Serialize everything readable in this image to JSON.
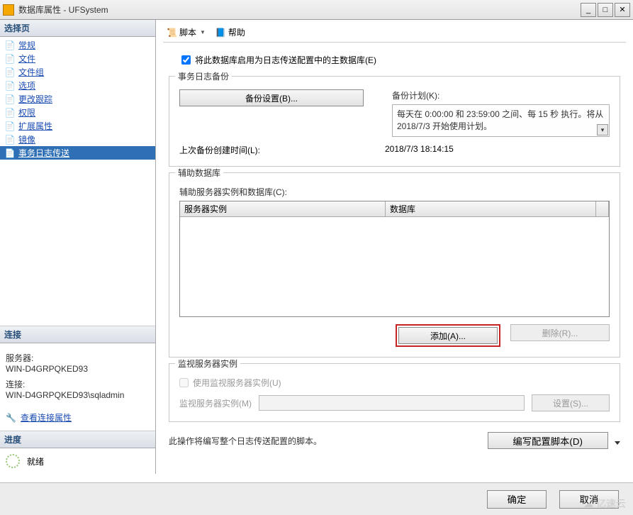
{
  "window": {
    "title": "数据库属性 - UFSystem"
  },
  "toolbar": {
    "script": "脚本",
    "help": "帮助"
  },
  "sidebar": {
    "select_page": "选择页",
    "items": [
      {
        "label": "常规"
      },
      {
        "label": "文件"
      },
      {
        "label": "文件组"
      },
      {
        "label": "选项"
      },
      {
        "label": "更改跟踪"
      },
      {
        "label": "权限"
      },
      {
        "label": "扩展属性"
      },
      {
        "label": "镜像"
      },
      {
        "label": "事务日志传送"
      }
    ],
    "connection_header": "连接",
    "server_label": "服务器:",
    "server_value": "WIN-D4GRPQKED93",
    "conn_label": "连接:",
    "conn_value": "WIN-D4GRPQKED93\\sqladmin",
    "view_props": "查看连接属性",
    "progress_header": "进度",
    "progress_status": "就绪"
  },
  "content": {
    "enable_primary": "将此数据库启用为日志传送配置中的主数据库(E)",
    "txlog_group": "事务日志备份",
    "backup_settings_btn": "备份设置(B)...",
    "schedule_label": "备份计划(K):",
    "schedule_text": "每天在 0:00:00 和 23:59:00 之间、每 15 秒 执行。将从 2018/7/3 开始使用计划。",
    "last_backup_label": "上次备份创建时间(L):",
    "last_backup_value": "2018/7/3 18:14:15",
    "secondary_group": "辅助数据库",
    "secondary_label": "辅助服务器实例和数据库(C):",
    "col_instance": "服务器实例",
    "col_database": "数据库",
    "add_btn": "添加(A)...",
    "delete_btn": "删除(R)...",
    "monitor_group": "监视服务器实例",
    "use_monitor": "使用监视服务器实例(U)",
    "monitor_label": "监视服务器实例(M)",
    "settings_btn": "设置(S)...",
    "note_text": "此操作将编写整个日志传送配置的脚本。",
    "write_script_btn": "编写配置脚本(D)"
  },
  "footer": {
    "ok": "确定",
    "cancel": "取消"
  },
  "watermark": "亿速云"
}
